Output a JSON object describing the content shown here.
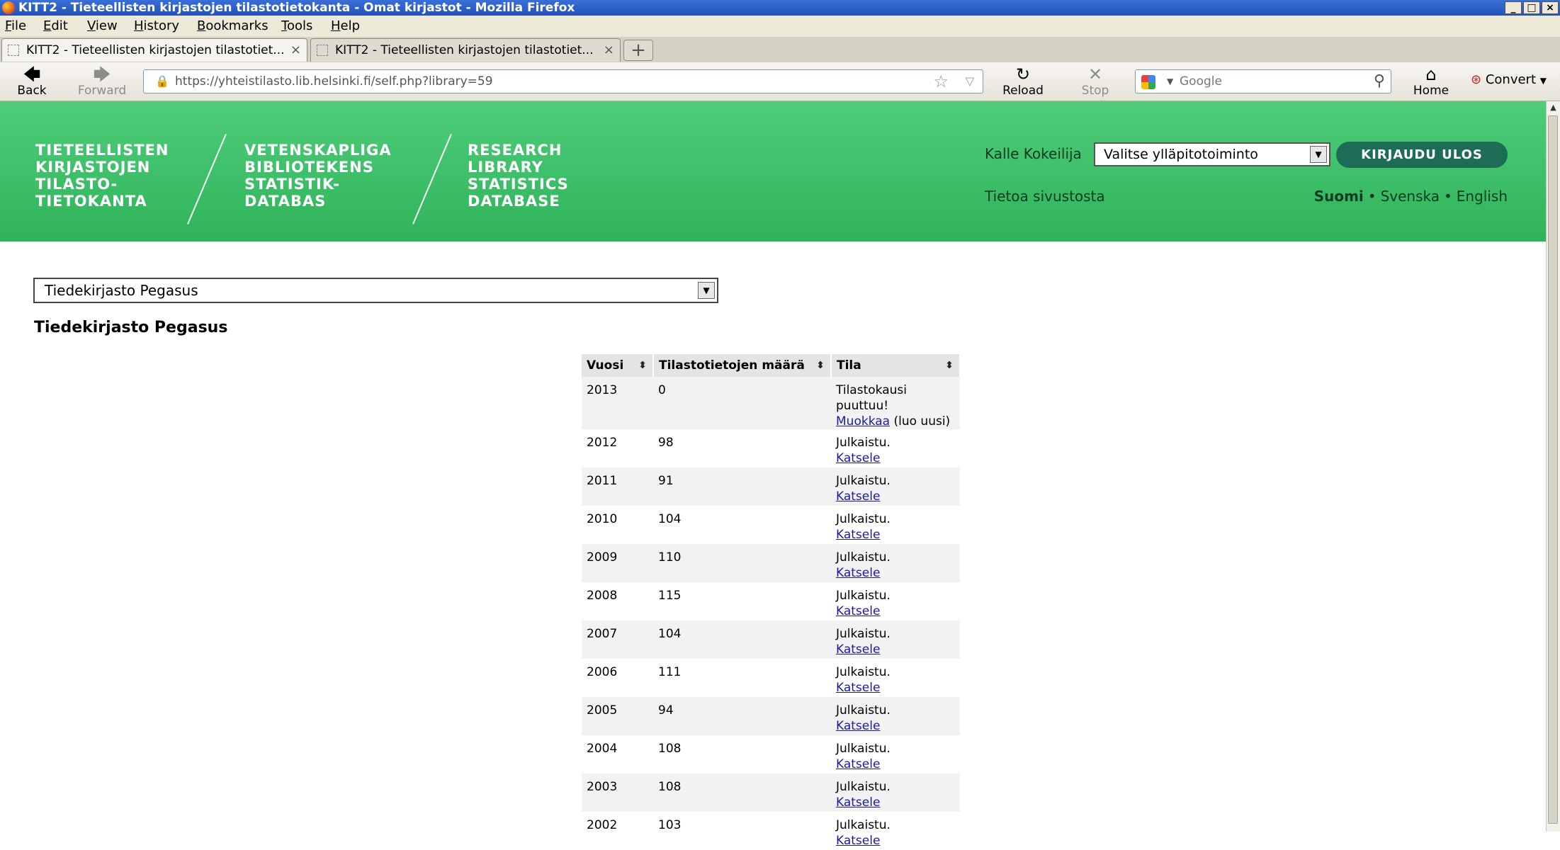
{
  "window": {
    "title": "KITT2 - Tieteellisten kirjastojen tilastotietokanta - Omat kirjastot - Mozilla Firefox",
    "min_label": "_",
    "max_label": "□",
    "close_label": "×"
  },
  "menu": [
    "File",
    "Edit",
    "View",
    "History",
    "Bookmarks",
    "Tools",
    "Help"
  ],
  "tabs": [
    {
      "label": "KITT2 - Tieteellisten kirjastojen tilastotiet...",
      "close": "×"
    },
    {
      "label": "KITT2 - Tieteellisten kirjastojen tilastotiet...",
      "close": "×"
    }
  ],
  "new_tab": "+",
  "nav": {
    "back": "Back",
    "forward": "Forward",
    "reload": "Reload",
    "stop": "Stop",
    "home": "Home",
    "convert": "Convert",
    "url": "https://yhteistilasto.lib.helsinki.fi/self.php?library=59",
    "search_placeholder": "Google"
  },
  "header": {
    "logo_fi": [
      "TIETEELLISTEN",
      "KIRJASTOJEN",
      "TILASTO-",
      "TIETOKANTA"
    ],
    "logo_sv": [
      "VETENSKAPLIGA",
      "BIBLIOTEKENS",
      "STATISTIK-",
      "DATABAS"
    ],
    "logo_en": [
      "RESEARCH",
      "LIBRARY",
      "STATISTICS",
      "DATABASE"
    ],
    "user_name": "Kalle Kokeilija",
    "admin_select": "Valitse ylläpitotoiminto",
    "logout": "KIRJAUDU ULOS",
    "about": "Tietoa sivustosta",
    "languages": [
      "Suomi",
      "Svenska",
      "English"
    ],
    "lang_sep": "•"
  },
  "library_select": "Tiedekirjasto Pegasus",
  "library_heading": "Tiedekirjasto Pegasus",
  "table": {
    "headers": [
      "Vuosi",
      "Tilastotietojen määrä",
      "Tila"
    ],
    "rows": [
      {
        "year": "2013",
        "count": "0",
        "status": "Tilastokausi puuttuu!",
        "link": "Muokkaa",
        "suffix": " (luo uusi)"
      },
      {
        "year": "2012",
        "count": "98",
        "status": "Julkaistu.",
        "link": "Katsele",
        "suffix": ""
      },
      {
        "year": "2011",
        "count": "91",
        "status": "Julkaistu.",
        "link": "Katsele",
        "suffix": ""
      },
      {
        "year": "2010",
        "count": "104",
        "status": "Julkaistu.",
        "link": "Katsele",
        "suffix": ""
      },
      {
        "year": "2009",
        "count": "110",
        "status": "Julkaistu.",
        "link": "Katsele",
        "suffix": ""
      },
      {
        "year": "2008",
        "count": "115",
        "status": "Julkaistu.",
        "link": "Katsele",
        "suffix": ""
      },
      {
        "year": "2007",
        "count": "104",
        "status": "Julkaistu.",
        "link": "Katsele",
        "suffix": ""
      },
      {
        "year": "2006",
        "count": "111",
        "status": "Julkaistu.",
        "link": "Katsele",
        "suffix": ""
      },
      {
        "year": "2005",
        "count": "94",
        "status": "Julkaistu.",
        "link": "Katsele",
        "suffix": ""
      },
      {
        "year": "2004",
        "count": "108",
        "status": "Julkaistu.",
        "link": "Katsele",
        "suffix": ""
      },
      {
        "year": "2003",
        "count": "108",
        "status": "Julkaistu.",
        "link": "Katsele",
        "suffix": ""
      },
      {
        "year": "2002",
        "count": "103",
        "status": "Julkaistu.",
        "link": "Katsele",
        "suffix": ""
      }
    ]
  },
  "colors": {
    "header_green": "#3cc067",
    "logout_bg": "#1c6c56",
    "link": "#1a1aa6"
  }
}
